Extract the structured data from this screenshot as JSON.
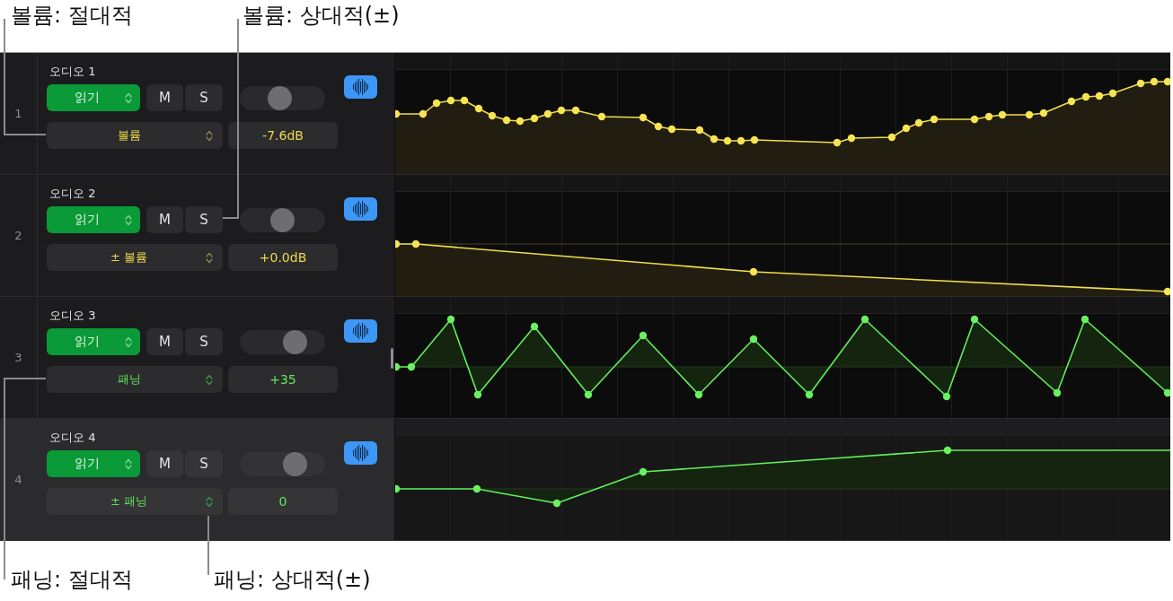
{
  "top_callouts": [
    {
      "text": "볼륨: 절대적"
    },
    {
      "text": "볼륨: 상대적(±)"
    }
  ],
  "tracks": [
    {
      "number": "1",
      "name": "오디오 1",
      "selected": false,
      "mode": "읽기",
      "mute": "M",
      "solo": "S",
      "slider": {
        "level": 0.45
      },
      "parameter": {
        "kind": "volume",
        "label": "볼륨",
        "value": "-7.6dB"
      }
    },
    {
      "number": "2",
      "name": "오디오 2",
      "selected": false,
      "mode": "읽기",
      "mute": "M",
      "solo": "S",
      "slider": {
        "level": 0.5
      },
      "parameter": {
        "kind": "volume",
        "label": "± 볼륨",
        "value": "+0.0dB"
      }
    },
    {
      "number": "3",
      "name": "오디오 3",
      "selected": false,
      "mode": "읽기",
      "mute": "M",
      "solo": "S",
      "slider": {
        "level": 0.7
      },
      "parameter": {
        "kind": "pan",
        "label": "패닝",
        "value": "+35"
      }
    },
    {
      "number": "4",
      "name": "오디오 4",
      "selected": true,
      "mode": "읽기",
      "mute": "M",
      "solo": "S",
      "slider": {
        "level": 0.7
      },
      "parameter": {
        "kind": "pan",
        "label": "± 패닝",
        "value": "0"
      }
    }
  ],
  "bottom_callouts": [
    {
      "text": "패닝: 절대적"
    },
    {
      "text": "패닝: 상대적(±)"
    }
  ]
}
